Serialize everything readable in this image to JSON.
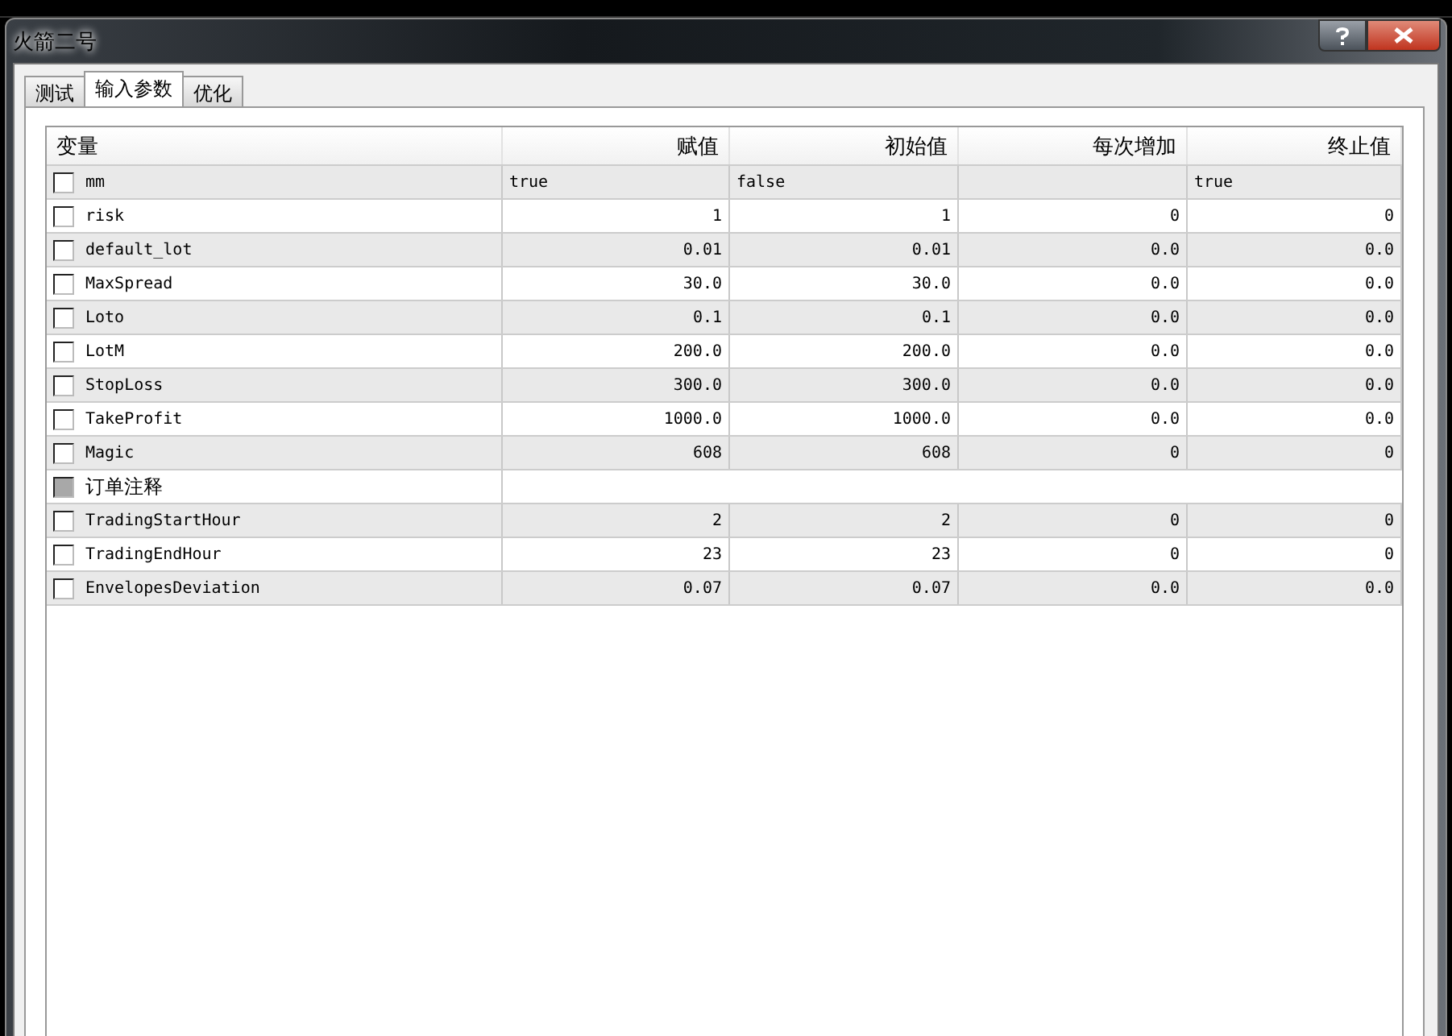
{
  "window": {
    "title": "火箭二号"
  },
  "tabs": [
    {
      "label": "测试",
      "selected": false
    },
    {
      "label": "输入参数",
      "selected": true
    },
    {
      "label": "优化",
      "selected": false
    }
  ],
  "table": {
    "columns": [
      "变量",
      "赋值",
      "初始值",
      "每次增加",
      "终止值"
    ],
    "rows": [
      {
        "name": "mm",
        "checked": false,
        "disabled": false,
        "kind": "text",
        "value": "true",
        "start": "false",
        "stop": "true"
      },
      {
        "name": "risk",
        "checked": false,
        "disabled": false,
        "kind": "number",
        "value": "1",
        "start": "1",
        "step": "0",
        "stop": "0"
      },
      {
        "name": "default_lot",
        "checked": false,
        "disabled": false,
        "kind": "number",
        "value": "0.01",
        "start": "0.01",
        "step": "0.0",
        "stop": "0.0"
      },
      {
        "name": "MaxSpread",
        "checked": false,
        "disabled": false,
        "kind": "number",
        "value": "30.0",
        "start": "30.0",
        "step": "0.0",
        "stop": "0.0"
      },
      {
        "name": "Loto",
        "checked": false,
        "disabled": false,
        "kind": "number",
        "value": "0.1",
        "start": "0.1",
        "step": "0.0",
        "stop": "0.0"
      },
      {
        "name": "LotM",
        "checked": false,
        "disabled": false,
        "kind": "number",
        "value": "200.0",
        "start": "200.0",
        "step": "0.0",
        "stop": "0.0"
      },
      {
        "name": "StopLoss",
        "checked": false,
        "disabled": false,
        "kind": "number",
        "value": "300.0",
        "start": "300.0",
        "step": "0.0",
        "stop": "0.0"
      },
      {
        "name": "TakeProfit",
        "checked": false,
        "disabled": false,
        "kind": "number",
        "value": "1000.0",
        "start": "1000.0",
        "step": "0.0",
        "stop": "0.0"
      },
      {
        "name": "Magic",
        "checked": false,
        "disabled": false,
        "kind": "number",
        "value": "608",
        "start": "608",
        "step": "0",
        "stop": "0"
      },
      {
        "name": "订单注释",
        "checked": false,
        "disabled": true,
        "kind": "string"
      },
      {
        "name": "TradingStartHour",
        "checked": false,
        "disabled": false,
        "kind": "number",
        "value": "2",
        "start": "2",
        "step": "0",
        "stop": "0"
      },
      {
        "name": "TradingEndHour",
        "checked": false,
        "disabled": false,
        "kind": "number",
        "value": "23",
        "start": "23",
        "step": "0",
        "stop": "0"
      },
      {
        "name": "EnvelopesDeviation",
        "checked": false,
        "disabled": false,
        "kind": "number",
        "value": "0.07",
        "start": "0.07",
        "step": "0.0",
        "stop": "0.0"
      }
    ]
  }
}
